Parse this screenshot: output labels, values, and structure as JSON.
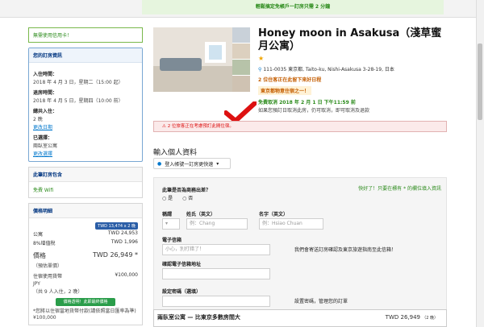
{
  "top": {
    "banner": "輕鬆搞定免帳戶一訂房只需 2 分鐘"
  },
  "left": {
    "notice": "無需使用信用卡！",
    "booking": {
      "title": "您的訂房資訊",
      "checkin_label": "入住時間：",
      "checkin_value": "2018 年 4 月 3 日，星期二（15:00 起）",
      "checkout_label": "退房時間：",
      "checkout_value": "2018 年 4 月 5 日，星期四（10:00 前）",
      "stay_label": "總共入住：",
      "stay_value": "2 晚",
      "change_dates": "更改日期",
      "selected_label": "已選擇：",
      "selected_value": "兩臥室公寓",
      "change_room": "更改選擇"
    },
    "includes": {
      "title": "此筆訂房包含",
      "item": "免費 Wifi"
    },
    "price": {
      "title": "價格明細",
      "badge": "TWD 13,474 x 2 晚",
      "row1_label": "公寓",
      "row1_value": "TWD 24,953",
      "row2_label": "8%增值稅",
      "row2_value": "TWD 1,996",
      "total_label": "價格",
      "total_sub": "（預估單價）",
      "total_value": "TWD 26,949 *",
      "local_label": "住宿使用貨幣",
      "local_sub": "JPY",
      "local_value": "¥100,000",
      "count_text": "（共 9 人入住，2 晚）",
      "cta": "價格透明！此即最終價格",
      "footnote": "*您將以住宿當地貨幣付款(請依照當日匯率為準)",
      "footnote2": "¥100,000"
    }
  },
  "hotel": {
    "title": "Honey moon in Asakusa（淺草蜜月公寓）",
    "address": "111-0035 東京都, Taito-ku, Nishi-Asakusa 3-28-19, 日本",
    "promo": "2 位住客正在此留下來好日程",
    "recommend": "東京都物意住宿之一！",
    "free_cancel": "免費取消 2018 年 2 月 1 日 下午11:59 前",
    "free_cancel_detail": "如果您預訂日取消此房，仍可取消，即可取消及退款"
  },
  "alert": "2 位旅客正在考慮預訂此間住宿。",
  "form": {
    "heading": "輸入個人資料",
    "signin": "登入帳號一訂房更快速",
    "tip": "快好了！只要在標有 * 的欄位填入資訊",
    "question": "此筆是否為商務出差？",
    "yes": "是",
    "no": "否",
    "salutation": "稱謂",
    "lastname": "姓氏（英文）",
    "lastname_ph": "例：Chang",
    "firstname": "名字（英文）",
    "firstname_ph": "例：Hsiao Chuan",
    "email": "電子信箱",
    "email_ph": "小心，別打錯了！",
    "email_note": "我們會寄送訂房確認及東京旅遊指南至此信箱！",
    "email_confirm": "確認電子信箱地址",
    "password": "設定密碼（選填）",
    "password_note": "設置密碼，管理您的訂單"
  },
  "summary": {
    "title": "兩臥室公寓 — 比東京多數房間大",
    "price": "TWD 26,949",
    "nights": "（2 晚）"
  }
}
